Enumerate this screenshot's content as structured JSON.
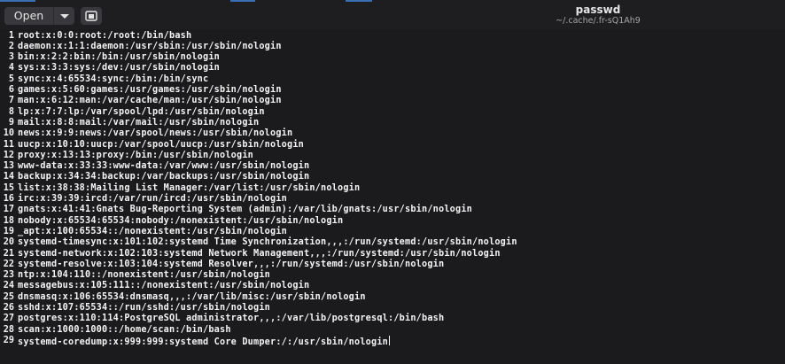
{
  "toolbar": {
    "open_label": "Open"
  },
  "icons": {
    "open_menu": "chevron-down-icon",
    "new_window": "new-window-icon"
  },
  "header": {
    "title": "passwd",
    "subtitle": "~/.cache/.fr-sQ1Ah9"
  },
  "editor": {
    "lines": [
      {
        "n": "1",
        "text": "root:x:0:0:root:/root:/bin/bash"
      },
      {
        "n": "2",
        "text": "daemon:x:1:1:daemon:/usr/sbin:/usr/sbin/nologin"
      },
      {
        "n": "3",
        "text": "bin:x:2:2:bin:/bin:/usr/sbin/nologin"
      },
      {
        "n": "4",
        "text": "sys:x:3:3:sys:/dev:/usr/sbin/nologin"
      },
      {
        "n": "5",
        "text": "sync:x:4:65534:sync:/bin:/bin/sync"
      },
      {
        "n": "6",
        "text": "games:x:5:60:games:/usr/games:/usr/sbin/nologin"
      },
      {
        "n": "7",
        "text": "man:x:6:12:man:/var/cache/man:/usr/sbin/nologin"
      },
      {
        "n": "8",
        "text": "lp:x:7:7:lp:/var/spool/lpd:/usr/sbin/nologin"
      },
      {
        "n": "9",
        "text": "mail:x:8:8:mail:/var/mail:/usr/sbin/nologin"
      },
      {
        "n": "10",
        "text": "news:x:9:9:news:/var/spool/news:/usr/sbin/nologin"
      },
      {
        "n": "11",
        "text": "uucp:x:10:10:uucp:/var/spool/uucp:/usr/sbin/nologin"
      },
      {
        "n": "12",
        "text": "proxy:x:13:13:proxy:/bin:/usr/sbin/nologin"
      },
      {
        "n": "13",
        "text": "www-data:x:33:33:www-data:/var/www:/usr/sbin/nologin"
      },
      {
        "n": "14",
        "text": "backup:x:34:34:backup:/var/backups:/usr/sbin/nologin"
      },
      {
        "n": "15",
        "text": "list:x:38:38:Mailing List Manager:/var/list:/usr/sbin/nologin"
      },
      {
        "n": "16",
        "text": "irc:x:39:39:ircd:/var/run/ircd:/usr/sbin/nologin"
      },
      {
        "n": "17",
        "text": "gnats:x:41:41:Gnats Bug-Reporting System (admin):/var/lib/gnats:/usr/sbin/nologin"
      },
      {
        "n": "18",
        "text": "nobody:x:65534:65534:nobody:/nonexistent:/usr/sbin/nologin"
      },
      {
        "n": "19",
        "text": "_apt:x:100:65534::/nonexistent:/usr/sbin/nologin"
      },
      {
        "n": "20",
        "text": "systemd-timesync:x:101:102:systemd Time Synchronization,,,:/run/systemd:/usr/sbin/nologin"
      },
      {
        "n": "21",
        "text": "systemd-network:x:102:103:systemd Network Management,,,:/run/systemd:/usr/sbin/nologin"
      },
      {
        "n": "22",
        "text": "systemd-resolve:x:103:104:systemd Resolver,,,:/run/systemd:/usr/sbin/nologin"
      },
      {
        "n": "23",
        "text": "ntp:x:104:110::/nonexistent:/usr/sbin/nologin"
      },
      {
        "n": "24",
        "text": "messagebus:x:105:111::/nonexistent:/usr/sbin/nologin"
      },
      {
        "n": "25",
        "text": "dnsmasq:x:106:65534:dnsmasq,,,:/var/lib/misc:/usr/sbin/nologin"
      },
      {
        "n": "26",
        "text": "sshd:x:107:65534::/run/sshd:/usr/sbin/nologin"
      },
      {
        "n": "27",
        "text": "postgres:x:110:114:PostgreSQL administrator,,,:/var/lib/postgresql:/bin/bash"
      },
      {
        "n": "28",
        "text": "scan:x:1000:1000::/home/scan:/bin/bash"
      },
      {
        "n": "29",
        "text": "systemd-coredump:x:999:999:systemd Core Dumper:/:/usr/sbin/nologin"
      }
    ]
  }
}
